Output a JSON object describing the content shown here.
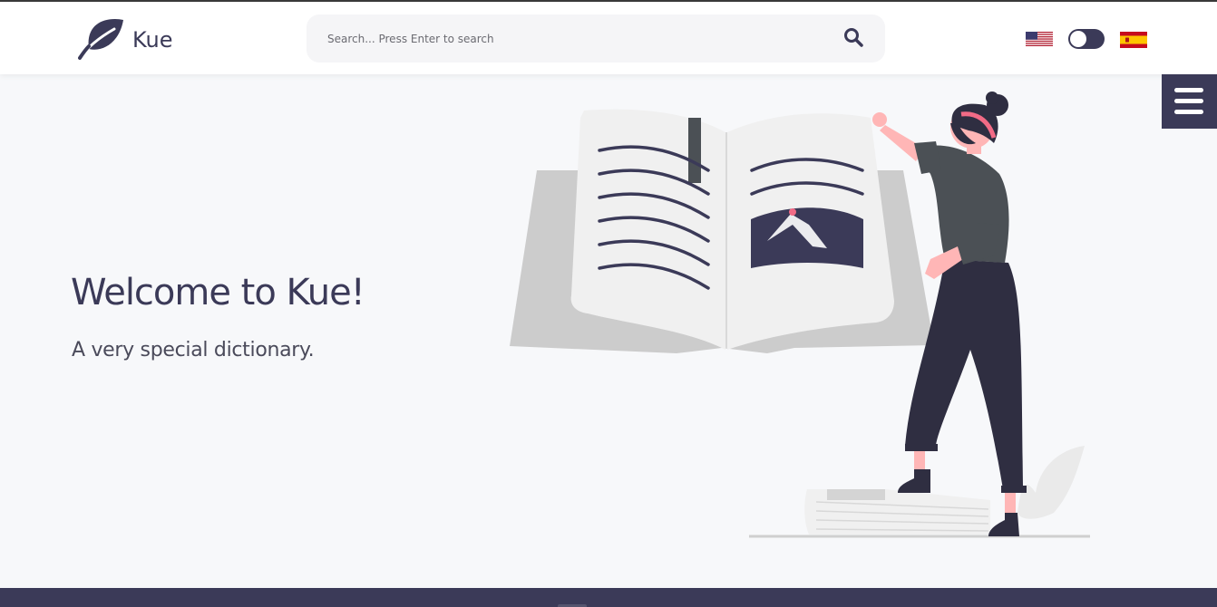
{
  "app": {
    "logo_text": "Kue",
    "logo_icon": "leaf-icon"
  },
  "search": {
    "placeholder": "Search... Press Enter to search",
    "value": "",
    "icon": "search-icon"
  },
  "header": {
    "language_english_icon": "us-flag-icon",
    "language_spanish_icon": "spain-flag-icon",
    "theme_toggle": "theme-toggle",
    "menu_icon": "hamburger-menu-icon"
  },
  "hero": {
    "title": "Welcome to Kue!",
    "subtitle": "A very special dictionary."
  },
  "colors": {
    "primary": "#3b3a58",
    "background": "#f7f8fa",
    "header_bg": "#ffffff",
    "search_bg": "#f5f5f7",
    "accent_pink": "#f26b86",
    "shirt": "#4b5055",
    "book_grey": "#cccccc"
  }
}
